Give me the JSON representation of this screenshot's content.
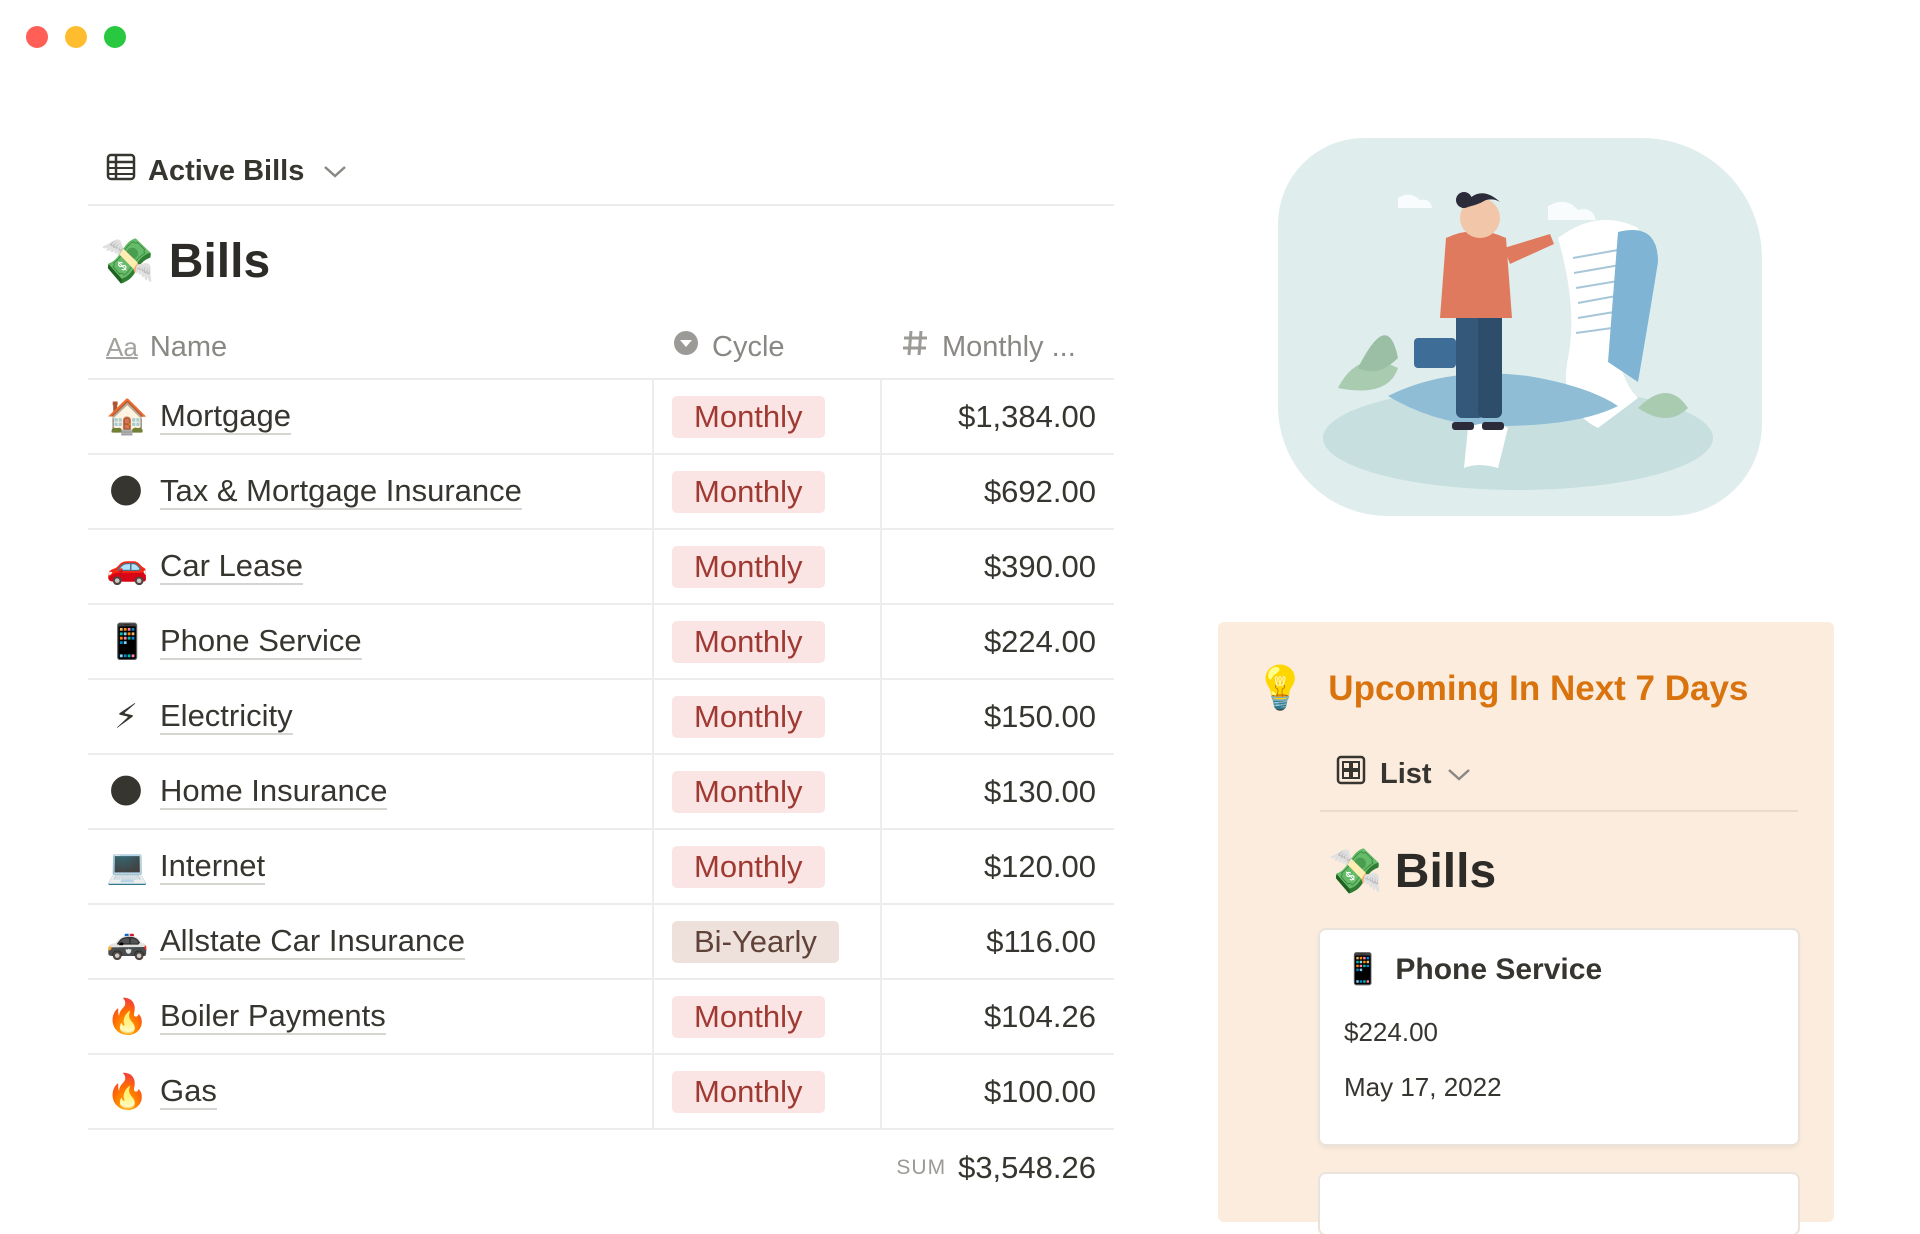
{
  "window": {
    "controls": [
      "close",
      "minimize",
      "zoom"
    ]
  },
  "table_view": {
    "switch_label": "Active Bills",
    "switch_icon": "table-icon",
    "db_title": "Bills",
    "db_icon": "money-emoji",
    "columns": [
      {
        "label": "Name",
        "icon": "text-property-icon"
      },
      {
        "label": "Cycle",
        "icon": "select-property-icon"
      },
      {
        "label": "Monthly ...",
        "icon": "number-property-icon"
      }
    ],
    "rows": [
      {
        "icon": "🏠",
        "name": "Mortgage",
        "cycle": "Monthly",
        "amount": "$1,384.00"
      },
      {
        "icon": "🌑",
        "name": "Tax & Mortgage Insurance",
        "cycle": "Monthly",
        "amount": "$692.00"
      },
      {
        "icon": "🚗",
        "name": "Car Lease",
        "cycle": "Monthly",
        "amount": "$390.00"
      },
      {
        "icon": "📱",
        "name": "Phone Service",
        "cycle": "Monthly",
        "amount": "$224.00"
      },
      {
        "icon": "⚡",
        "name": "Electricity",
        "cycle": "Monthly",
        "amount": "$150.00"
      },
      {
        "icon": "🌑",
        "name": "Home Insurance",
        "cycle": "Monthly",
        "amount": "$130.00"
      },
      {
        "icon": "💻",
        "name": "Internet",
        "cycle": "Monthly",
        "amount": "$120.00"
      },
      {
        "icon": "🚓",
        "name": "Allstate Car Insurance",
        "cycle": "Bi-Yearly",
        "amount": "$116.00"
      },
      {
        "icon": "🔥",
        "name": "Boiler Payments",
        "cycle": "Monthly",
        "amount": "$104.26"
      },
      {
        "icon": "🔥",
        "name": "Gas",
        "cycle": "Monthly",
        "amount": "$100.00"
      }
    ],
    "sum_label": "SUM",
    "sum_value": "$3,548.26"
  },
  "callout": {
    "icon": "💡",
    "title": "Upcoming In Next 7 Days",
    "view_label": "List",
    "view_icon": "gallery-icon",
    "db_title": "Bills",
    "card": {
      "icon": "📱",
      "title": "Phone Service",
      "amount": "$224.00",
      "date": "May 17, 2022"
    }
  },
  "colors": {
    "monthly_tag_bg": "#fbe4e4",
    "biyearly_tag_bg": "#eee0da",
    "callout_bg": "#fbecdd",
    "callout_title": "#d9730d"
  }
}
